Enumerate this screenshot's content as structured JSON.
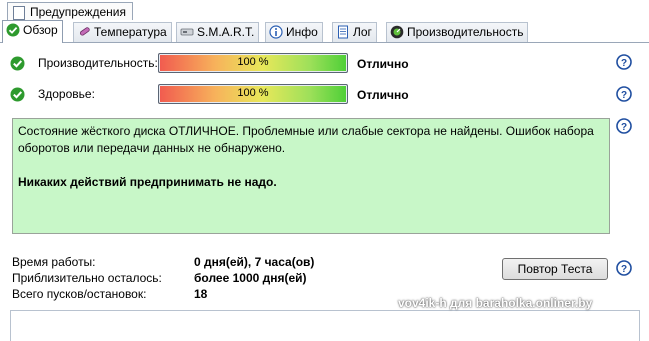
{
  "window": {
    "top_tab_label": "Предупреждения"
  },
  "tabs": [
    {
      "label": "Обзор",
      "icon": "check-circle-icon",
      "active": true
    },
    {
      "label": "Температура",
      "icon": "thermometer-icon",
      "active": false
    },
    {
      "label": "S.M.A.R.T.",
      "icon": "drive-icon",
      "active": false
    },
    {
      "label": "Инфо",
      "icon": "info-icon",
      "active": false
    },
    {
      "label": "Лог",
      "icon": "log-document-icon",
      "active": false
    },
    {
      "label": "Производительность",
      "icon": "gauge-icon",
      "active": false
    }
  ],
  "overview": {
    "performance": {
      "label": "Производительность:",
      "percent_text": "100 %",
      "level": 1.0,
      "status": "Отлично"
    },
    "health": {
      "label": "Здоровье:",
      "percent_text": "100 %",
      "level": 1.0,
      "status": "Отлично"
    },
    "message": {
      "text": "Состояние жёсткого диска ОТЛИЧНОЕ. Проблемные или слабые сектора не найдены. Ошибок набора оборотов или передачи данных не обнаружено.",
      "recommendation": "Никаких действий предпринимать не надо."
    },
    "uptime": {
      "label": "Время работы:",
      "value": "0 дня(ей), 7 часа(ов)"
    },
    "remaining": {
      "label": "Приблизительно осталось:",
      "value": "более 1000 дня(ей)"
    },
    "starts": {
      "label": "Всего пусков/остановок:",
      "value": "18"
    },
    "retest_button": "Повтор Теста"
  },
  "colors": {
    "ok_green": "#2e9a2e",
    "message_bg": "#c8f7c8",
    "help_blue": "#1f4ea0"
  },
  "watermark": "vov4ik-h для baraholka.onliner.by"
}
